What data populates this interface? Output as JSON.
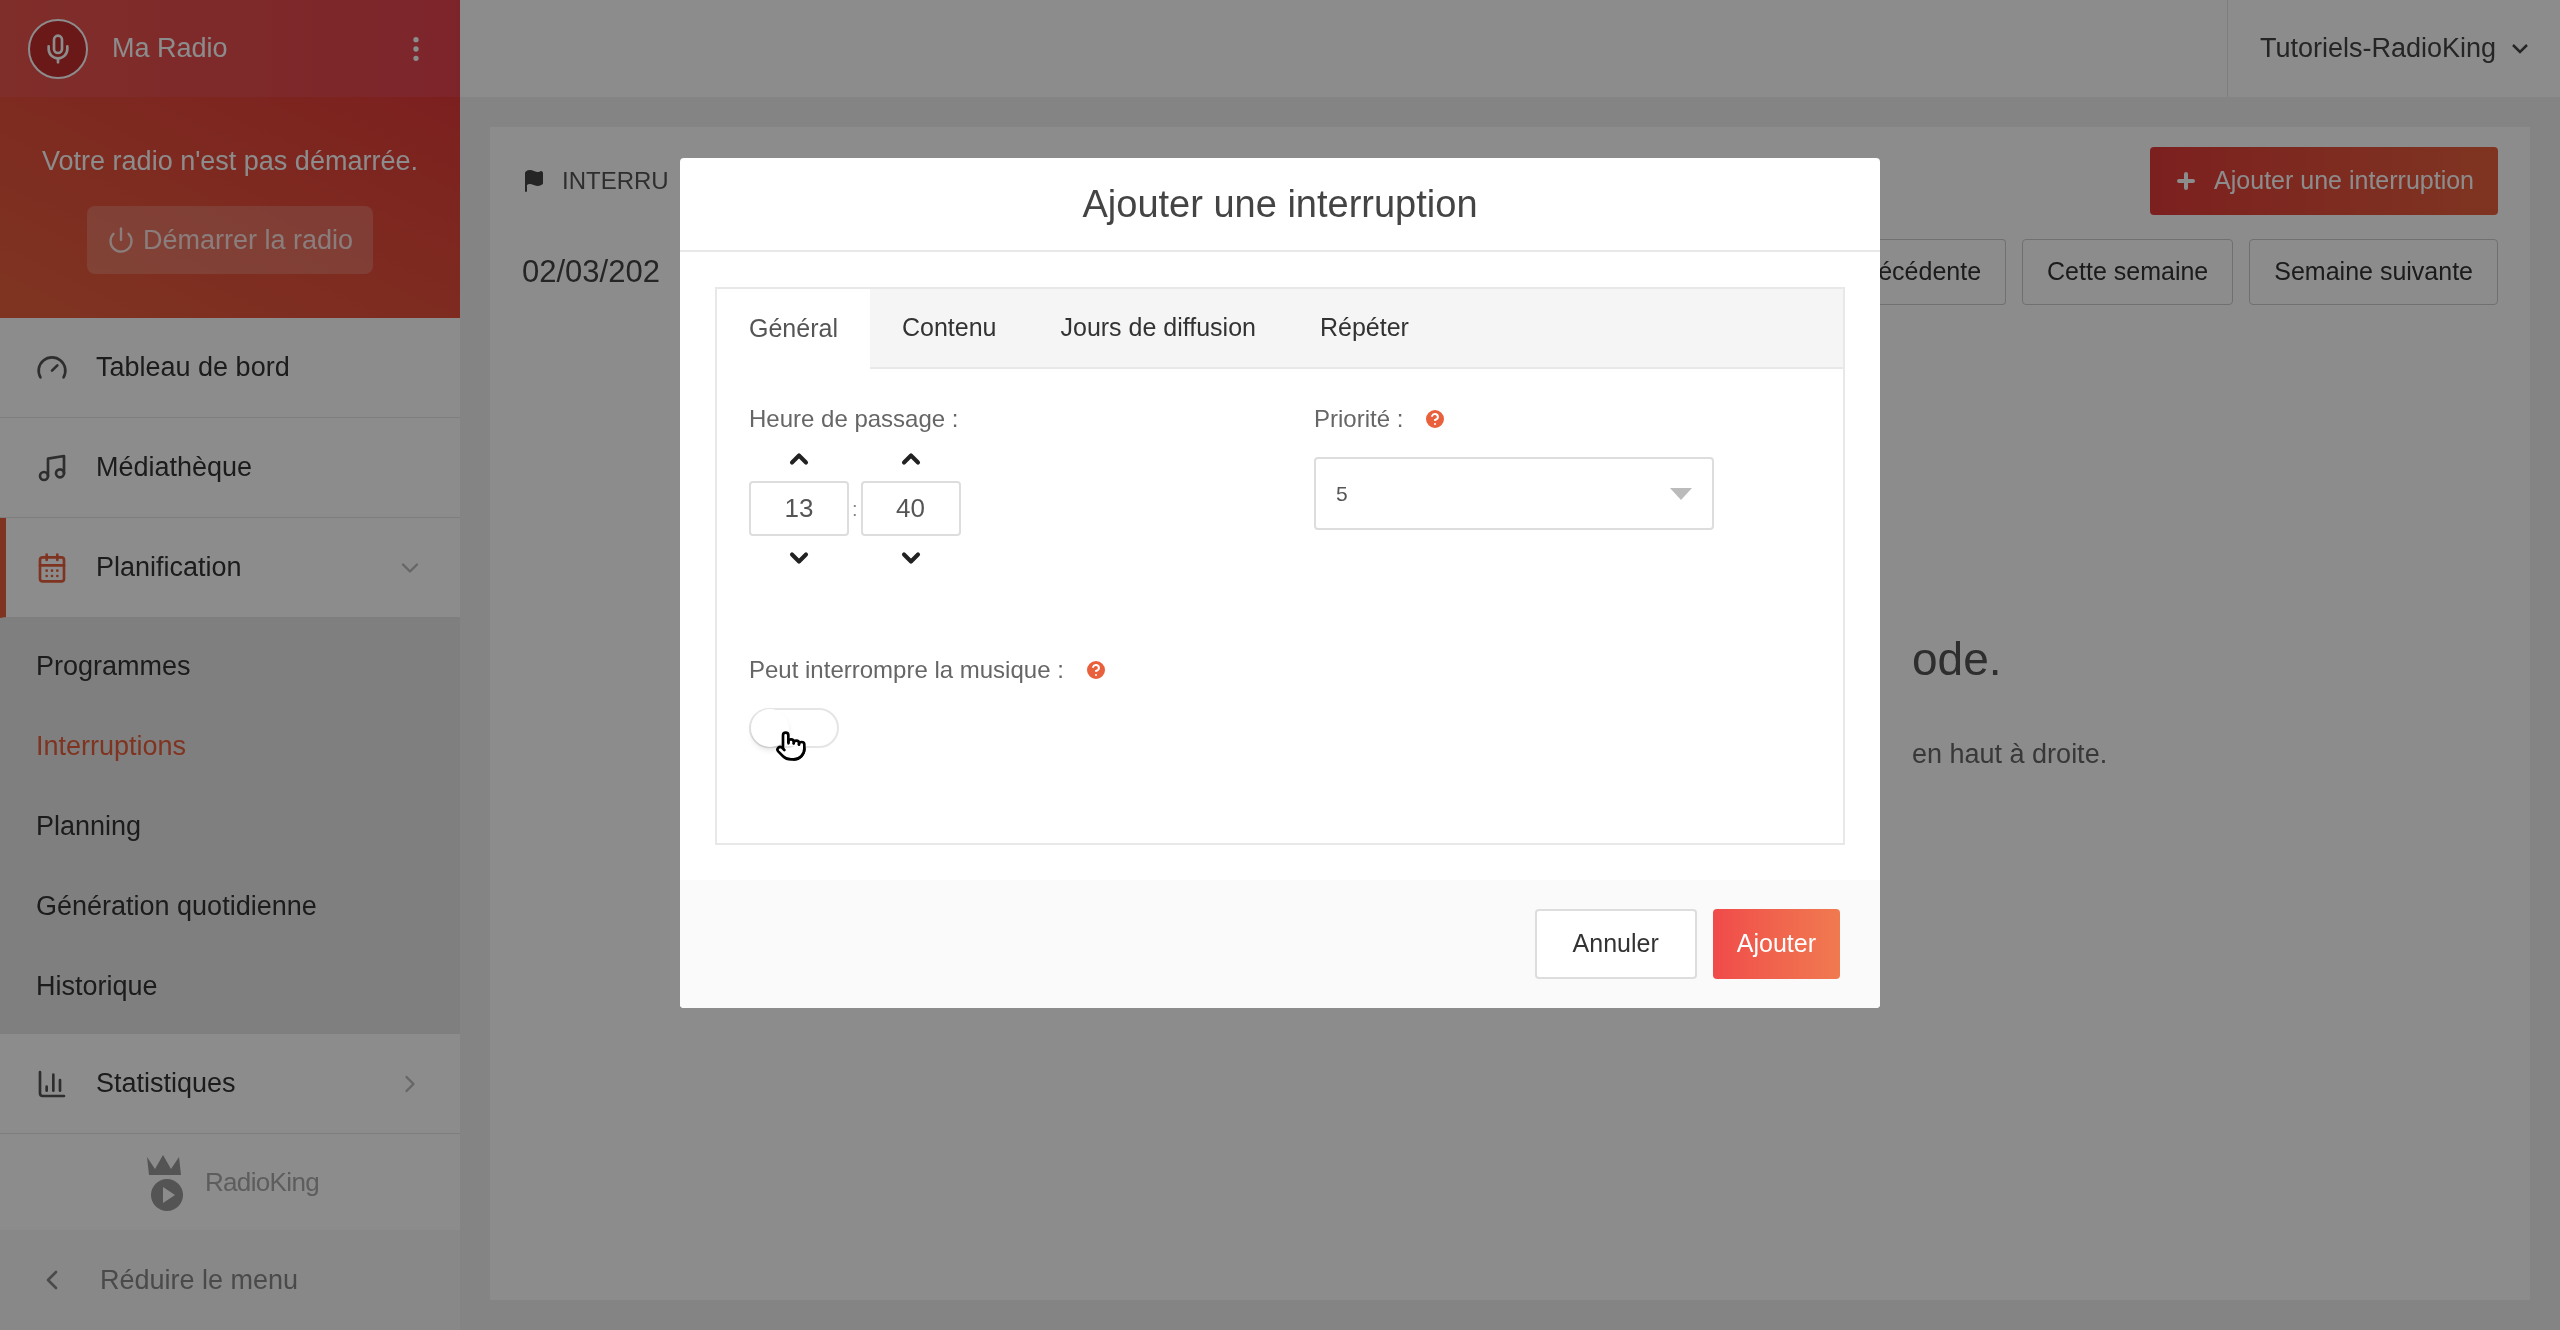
{
  "sidebar": {
    "station": {
      "name": "Ma Radio"
    },
    "status": {
      "message": "Votre radio n'est pas démarrée.",
      "button": "Démarrer la radio",
      "disabled": true
    },
    "items": [
      {
        "label": "Tableau de bord",
        "selected": false
      },
      {
        "label": "Médiathèque",
        "selected": false
      },
      {
        "label": "Planification",
        "selected": true,
        "expanded": true,
        "children": [
          {
            "label": "Programmes",
            "selected": false
          },
          {
            "label": "Interruptions",
            "selected": true
          },
          {
            "label": "Planning",
            "selected": false
          },
          {
            "label": "Génération quotidienne",
            "selected": false
          },
          {
            "label": "Historique",
            "selected": false
          }
        ]
      },
      {
        "label": "Statistiques",
        "selected": false,
        "expanded": false
      }
    ],
    "logo": {
      "text": "RadioKing"
    },
    "collapse": "Réduire le menu"
  },
  "header": {
    "account": "Tutoriels-RadioKing"
  },
  "page": {
    "title": "INTERRU",
    "date": "02/03/202",
    "add_button": "Ajouter une interruption",
    "week_buttons": [
      "écédente",
      "Cette semaine",
      "Semaine suivante"
    ],
    "empty_title": "ode.",
    "empty_hint": "en haut à droite."
  },
  "modal": {
    "title": "Ajouter une interruption",
    "tabs": [
      {
        "label": "Général",
        "selected": true
      },
      {
        "label": "Contenu",
        "selected": false
      },
      {
        "label": "Jours de diffusion",
        "selected": false
      },
      {
        "label": "Répéter",
        "selected": false
      }
    ],
    "time": {
      "label": "Heure de passage :",
      "hours": "13",
      "separator": ":",
      "minutes": "40"
    },
    "priority": {
      "label": "Priorité :",
      "value": "5"
    },
    "interrupt_music": {
      "label": "Peut interrompre la musique :",
      "on": false
    },
    "buttons": {
      "cancel": "Annuler",
      "submit": "Ajouter"
    }
  }
}
